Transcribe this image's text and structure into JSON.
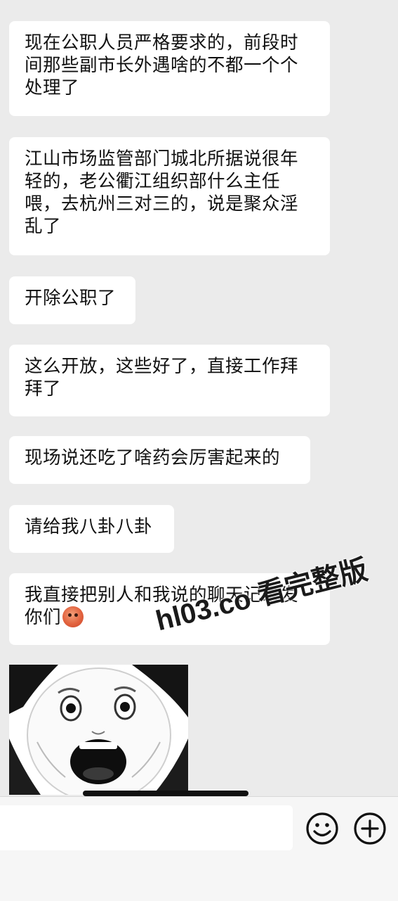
{
  "messages": [
    {
      "lines": [
        "现在公职人员严格要求的，前段时",
        "间那些副市长外遇啥的不都一个个",
        "处理了"
      ]
    },
    {
      "lines": [
        "江山市场监管部门城北所据说很年",
        "轻的，老公衢江组织部什么主任",
        "喂，去杭州三对三的，说是聚众淫",
        "乱了"
      ]
    },
    {
      "lines": [
        "开除公职了"
      ]
    },
    {
      "lines": [
        "这么开放，这些好了，直接工作拜",
        "拜了"
      ]
    },
    {
      "lines": [
        "现场说还吃了啥药会厉害起来的"
      ]
    },
    {
      "lines": [
        "请给我八卦八卦"
      ]
    },
    {
      "lines": [
        "我直接把别人和我说的聊天记录发",
        "你们"
      ]
    }
  ],
  "sticker": {
    "type": "image",
    "icon": "panda-face-meme"
  },
  "watermark": {
    "text": "hl03.co 看完整版"
  },
  "input_bar": {
    "placeholder": "",
    "emoji_button_icon": "smiley-icon",
    "more_button_icon": "plus-circle-icon"
  }
}
